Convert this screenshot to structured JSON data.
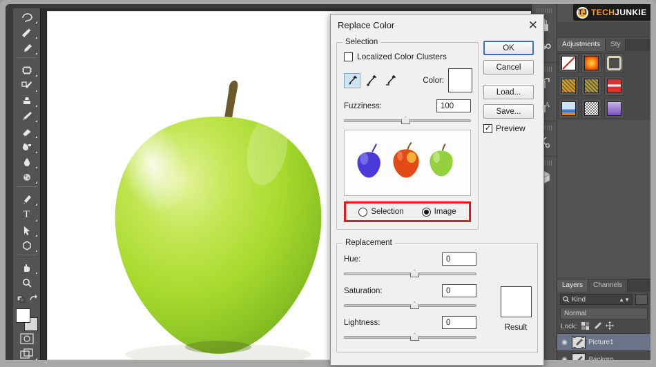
{
  "app": {
    "logo": {
      "mark": "TJ",
      "text_a": "TECH",
      "text_b": "JUNKIE"
    }
  },
  "toolbar": {
    "tools": [
      {
        "name": "lasso-tool",
        "glyph": "lasso"
      },
      {
        "name": "quick-selection-tool",
        "glyph": "quick-select"
      },
      {
        "name": "eyedropper-tool",
        "glyph": "eyedropper"
      },
      {
        "name": "spot-healing-brush-tool",
        "glyph": "healing"
      },
      {
        "name": "brush-tool",
        "glyph": "brush"
      },
      {
        "name": "clone-stamp-tool",
        "glyph": "stamp"
      },
      {
        "name": "history-brush-tool",
        "glyph": "history-brush"
      },
      {
        "name": "eraser-tool",
        "glyph": "eraser"
      },
      {
        "name": "gradient-tool",
        "glyph": "gradient"
      },
      {
        "name": "blur-tool",
        "glyph": "blur"
      },
      {
        "name": "dodge-tool",
        "glyph": "dodge"
      },
      {
        "name": "pen-tool",
        "glyph": "pen"
      },
      {
        "name": "type-tool",
        "glyph": "T"
      },
      {
        "name": "path-selection-tool",
        "glyph": "arrow"
      },
      {
        "name": "shape-tool",
        "glyph": "polygon"
      },
      {
        "name": "hand-tool",
        "glyph": "hand"
      },
      {
        "name": "zoom-tool",
        "glyph": "magnifier"
      }
    ],
    "foreground_color": "#ffffff",
    "background_color": "#d9d9d9"
  },
  "icon_dock": {
    "items": [
      {
        "name": "brushes-panel-icon",
        "glyph": "brushes"
      },
      {
        "name": "clone-source-panel-icon",
        "glyph": "clone-source"
      },
      {
        "name": "layer-comps-panel-icon",
        "glyph": "layer-comps"
      },
      {
        "name": "paragraph-styles-panel-icon",
        "glyph": "para-styles"
      },
      {
        "name": "tool-presets-panel-icon",
        "glyph": "tools"
      },
      {
        "name": "3d-panel-icon",
        "glyph": "cube"
      }
    ]
  },
  "adjustments_panel": {
    "tabs": [
      {
        "label": "Adjustments",
        "active": true
      },
      {
        "label": "Sty",
        "active": false
      }
    ],
    "swatches": [
      {
        "name": "no-style",
        "color": "#ffffff"
      },
      {
        "name": "style-orange-glow",
        "color": "#ff6a00"
      },
      {
        "name": "style-beveled-frame",
        "color": "#cfcf9a"
      },
      {
        "name": "style-gold-texture",
        "color": "#d6a23c"
      },
      {
        "name": "style-olive-texture",
        "color": "#b5a04a"
      },
      {
        "name": "style-red-stripe",
        "color": "#e03030"
      },
      {
        "name": "style-blue-bar",
        "color": "#3b7fd4"
      },
      {
        "name": "style-noise",
        "color": "#cfcfcf"
      },
      {
        "name": "style-purple-gradient",
        "color": "#9a6fd0"
      }
    ]
  },
  "layers_panel": {
    "tabs": [
      {
        "label": "Layers",
        "active": true
      },
      {
        "label": "Channels",
        "active": false
      }
    ],
    "filter_kind": "Kind",
    "blend_mode": "Normal",
    "lock_label": "Lock:",
    "rows": [
      {
        "name": "Picture1",
        "selected": true
      },
      {
        "name": "Backgro",
        "selected": false
      }
    ]
  },
  "dialog": {
    "title": "Replace Color",
    "close_icon": "✕",
    "selection": {
      "legend": "Selection",
      "localized_checkbox": {
        "label": "Localized Color Clusters",
        "checked": false
      },
      "eyedroppers": [
        {
          "name": "eyedropper-sample",
          "selected": true
        },
        {
          "name": "eyedropper-add",
          "selected": false
        },
        {
          "name": "eyedropper-subtract",
          "selected": false
        }
      ],
      "color_label": "Color:",
      "color_value": "#ffffff",
      "fuzziness_label": "Fuzziness:",
      "fuzziness_value": "100",
      "fuzziness_percent": 45,
      "preview_mode": [
        {
          "label": "Selection",
          "checked": false
        },
        {
          "label": "Image",
          "checked": true
        }
      ],
      "highlight_color": "#e8191b",
      "thumbnail_apples": [
        {
          "name": "apple-blue",
          "color": "#4b39d8"
        },
        {
          "name": "apple-red",
          "color": "#e24a16"
        },
        {
          "name": "apple-green",
          "color": "#93d13e"
        }
      ]
    },
    "replacement": {
      "legend": "Replacement",
      "hue_label": "Hue:",
      "hue_value": "0",
      "saturation_label": "Saturation:",
      "saturation_value": "0",
      "lightness_label": "Lightness:",
      "lightness_value": "0",
      "slider_percent": 50,
      "result_label": "Result",
      "result_color": "#ffffff"
    },
    "buttons": {
      "ok": "OK",
      "cancel": "Cancel",
      "load": "Load...",
      "save": "Save...",
      "preview": {
        "label": "Preview",
        "checked": true
      }
    }
  },
  "canvas": {
    "document_name": "green-apple",
    "background": "#ffffff",
    "apple_color": "#a4d92b"
  }
}
